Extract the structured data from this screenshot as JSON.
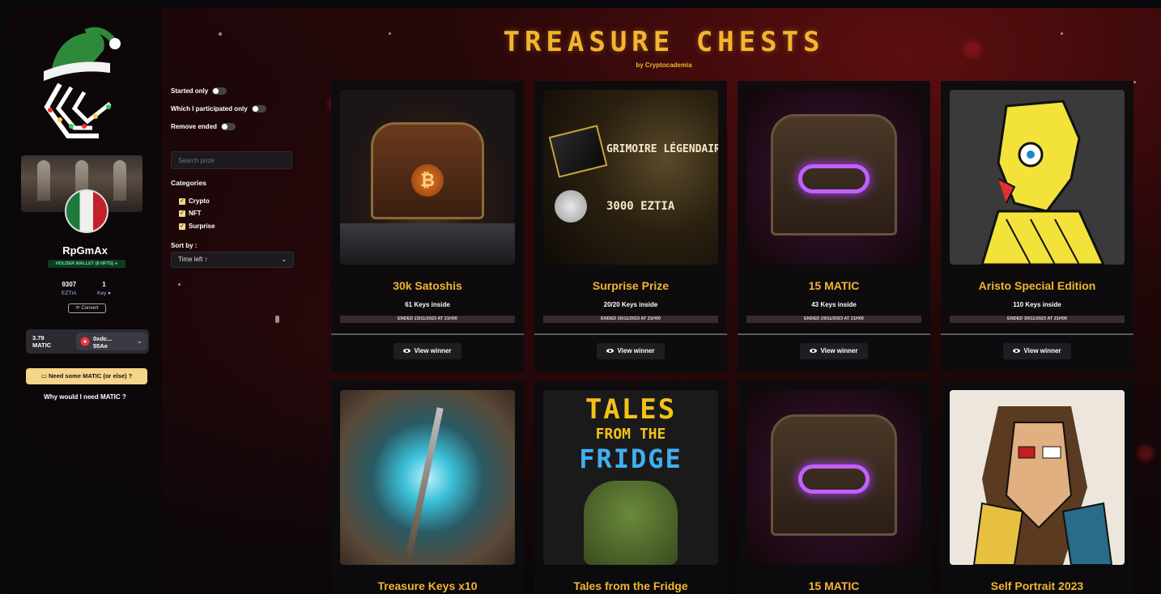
{
  "app": {
    "brand_title": "TREASURE CHESTS",
    "brand_subtitle": "by Cryptocademia"
  },
  "sidebar": {
    "username": "RpGmAx",
    "holder_badge": "HOLDER WALLET (8 NFTS)",
    "stats": [
      {
        "value": "9307",
        "label": "EZTIA"
      },
      {
        "value": "1",
        "label": "Key"
      }
    ],
    "convert_label": "Convert",
    "wallet": {
      "balance_line1": "3.79",
      "balance_line2": "MATIC",
      "address_line1": "0xdc...",
      "address_line2": "55Ae"
    },
    "need_matic_label": "Need some MATIC (or else) ?",
    "why_matic_label": "Why would I need MATIC"
  },
  "filters": {
    "toggles": [
      {
        "label": "Started only",
        "on": false
      },
      {
        "label": "Which I participated only",
        "on": false
      },
      {
        "label": "Remove ended",
        "on": false
      }
    ],
    "search_placeholder": "Search prize",
    "categories_title": "Categories",
    "categories": [
      {
        "label": "Crypto",
        "checked": true
      },
      {
        "label": "NFT",
        "checked": true
      },
      {
        "label": "Surprise",
        "checked": true
      }
    ],
    "sort_label": "Sort by :",
    "sort_value": "Time left ↑"
  },
  "cards": [
    {
      "title": "30k Satoshis",
      "keys": "61 Keys inside",
      "ended": "ENDED 23/11/2023 AT 21H00",
      "button": "View winner",
      "art": "btc-chest"
    },
    {
      "title": "Surprise Prize",
      "keys": "20/20 Keys inside",
      "ended": "ENDED 26/11/2023 AT 21H00",
      "button": "View winner",
      "art": "grimoire",
      "art_text1": "GRIMOIRE LÉGENDAIRE",
      "art_text2": "3000 EZTIA"
    },
    {
      "title": "15 MATIC",
      "keys": "43 Keys inside",
      "ended": "ENDED 29/11/2023 AT 21H00",
      "button": "View winner",
      "art": "matic-chest"
    },
    {
      "title": "Aristo Special Edition",
      "keys": "110 Keys inside",
      "ended": "ENDED 30/11/2023 AT 21H00",
      "button": "View winner",
      "art": "aristo"
    },
    {
      "title": "Treasure Keys x10",
      "art": "keys"
    },
    {
      "title": "Tales from the Fridge",
      "art": "fridge",
      "art_text1": "TALES",
      "art_text2": "FROM THE",
      "art_text3": "FRIDGE"
    },
    {
      "title": "15 MATIC",
      "art": "matic-chest"
    },
    {
      "title": "Self Portrait 2023",
      "art": "portrait"
    }
  ],
  "colors": {
    "accent_gold": "#f3b530",
    "button_cream": "#f6d48a",
    "badge_green": "#5fe39a"
  }
}
